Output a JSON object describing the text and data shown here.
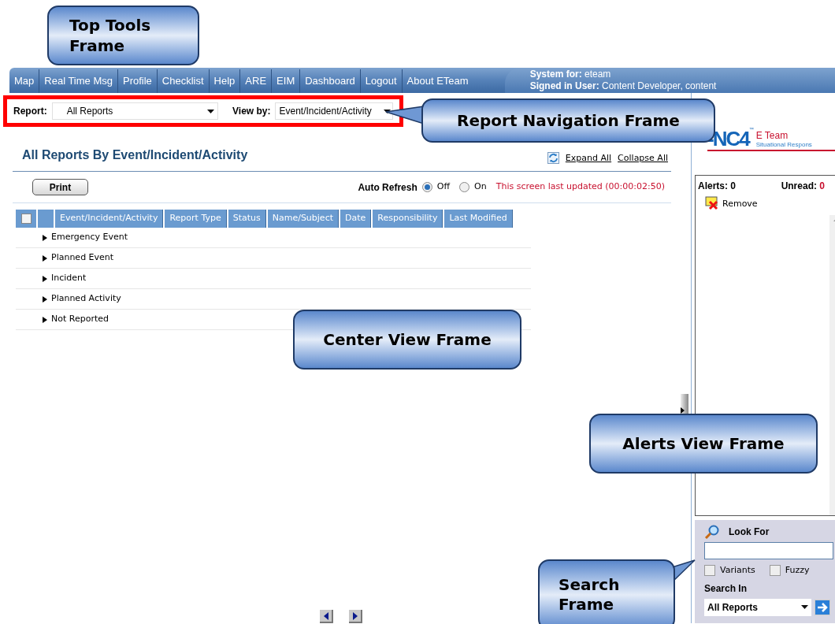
{
  "nav": {
    "items": [
      "Map",
      "Real Time Msg",
      "Profile",
      "Checklist",
      "Help",
      "ARE",
      "EIM",
      "Dashboard",
      "Logout",
      "About ETeam"
    ],
    "system_label": "System for:",
    "system_value": "eteam",
    "user_label": "Signed in User:",
    "user_value": "Content Developer, content"
  },
  "report_nav": {
    "report_label": "Report:",
    "report_value": "All Reports",
    "viewby_label": "View by:",
    "viewby_value": "Event/Incident/Activity"
  },
  "logo": {
    "mark": "-NC4",
    "tm": "™",
    "name": "E Team",
    "tagline": "Situational Respons"
  },
  "center": {
    "title": "All Reports By Event/Incident/Activity",
    "expand": "Expand All",
    "collapse": "Collapse All",
    "print": "Print",
    "auto_refresh": "Auto Refresh",
    "refresh_options": [
      {
        "label": "Off",
        "selected": true
      },
      {
        "label": "On",
        "selected": false
      }
    ],
    "last_updated": "This screen last updated (00:00:02:50)",
    "select_all_checked": false,
    "columns": [
      "Event/Incident/Activity",
      "Report Type",
      "Status",
      "Name/Subject",
      "Date",
      "Responsibility",
      "Last Modified"
    ],
    "groups": [
      {
        "label": "Emergency Event",
        "expanded": false
      },
      {
        "label": "Planned Event",
        "expanded": false
      },
      {
        "label": "Incident",
        "expanded": false
      },
      {
        "label": "Planned Activity",
        "expanded": false
      },
      {
        "label": "Not Reported",
        "expanded": false
      }
    ]
  },
  "alerts": {
    "alerts_label": "Alerts:",
    "alerts_count": "0",
    "unread_label": "Unread:",
    "unread_count": "0",
    "remove": "Remove"
  },
  "search": {
    "title": "Look For",
    "options": [
      {
        "label": "Variants",
        "checked": false
      },
      {
        "label": "Fuzzy",
        "checked": false
      }
    ],
    "search_in_label": "Search In",
    "search_in_value": "All Reports"
  },
  "annotations": [
    "Top Tools Frame",
    "Report Navigation Frame",
    "Center View Frame",
    "Alerts View Frame",
    "Search Frame"
  ]
}
